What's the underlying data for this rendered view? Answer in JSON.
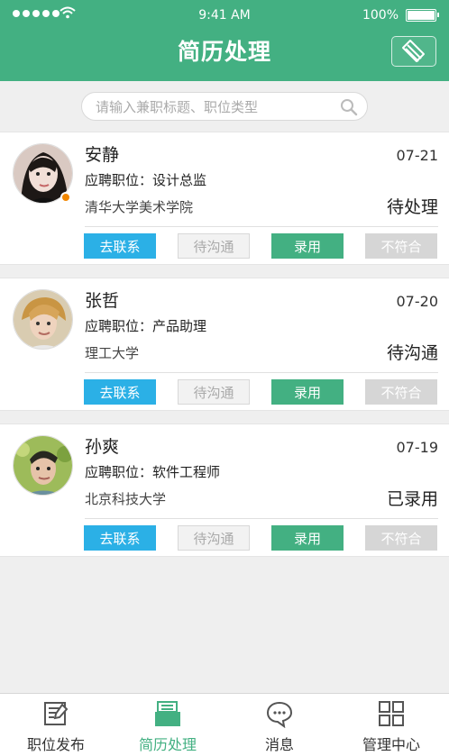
{
  "status_bar": {
    "time": "9:41 AM",
    "battery": "100%"
  },
  "header": {
    "title": "简历处理",
    "action_icon": "stack-icon"
  },
  "search": {
    "placeholder": "请输入兼职标题、职位类型",
    "value": ""
  },
  "candidates": [
    {
      "name": "安静",
      "date": "07-21",
      "position_prefix": "应聘职位：",
      "position": "设计总监",
      "school": "清华大学美术学院",
      "status": "待处理",
      "avatar_style": "dark-hair-female",
      "online": true,
      "actions": [
        "去联系",
        "待沟通",
        "录用",
        "不符合"
      ]
    },
    {
      "name": "张哲",
      "date": "07-20",
      "position_prefix": "应聘职位：",
      "position": "产品助理",
      "school": "理工大学",
      "status": "待沟通",
      "avatar_style": "blond-male",
      "online": false,
      "actions": [
        "去联系",
        "待沟通",
        "录用",
        "不符合"
      ]
    },
    {
      "name": "孙爽",
      "date": "07-19",
      "position_prefix": "应聘职位：",
      "position": "软件工程师",
      "school": "北京科技大学",
      "status": "已录用",
      "avatar_style": "outdoor-male",
      "online": false,
      "actions": [
        "去联系",
        "待沟通",
        "录用",
        "不符合"
      ]
    }
  ],
  "tabs": [
    {
      "label": "职位发布",
      "icon": "post-job-icon",
      "active": false
    },
    {
      "label": "简历处理",
      "icon": "resume-icon",
      "active": true
    },
    {
      "label": "消息",
      "icon": "message-icon",
      "active": false
    },
    {
      "label": "管理中心",
      "icon": "grid-icon",
      "active": false
    }
  ],
  "colors": {
    "brand_green": "#43b082",
    "contact_blue": "#2bb0e6",
    "muted_gray": "#d6d6d6",
    "online_orange": "#f28700"
  }
}
